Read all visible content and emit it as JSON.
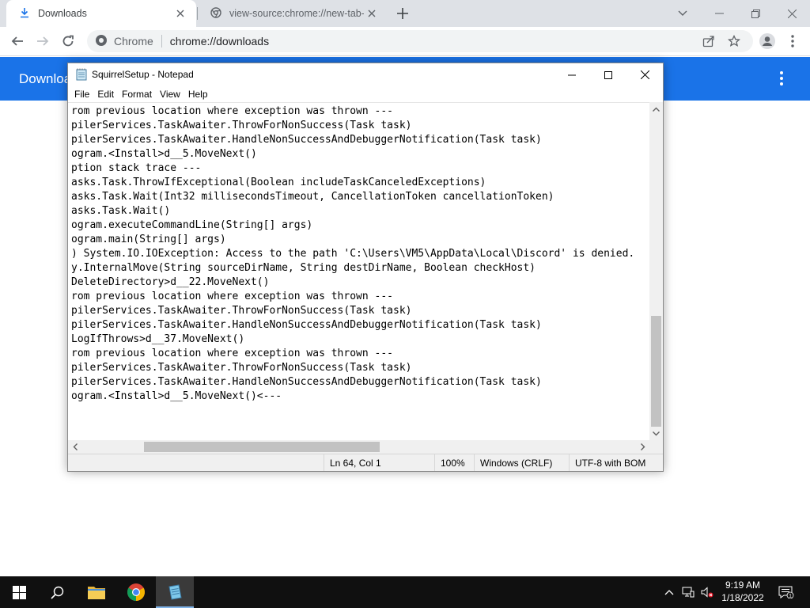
{
  "browser": {
    "tabs": [
      {
        "title": "Downloads"
      },
      {
        "title": "view-source:chrome://new-tab-p"
      }
    ],
    "omnibox": {
      "site_label": "Chrome",
      "url": "chrome://downloads"
    }
  },
  "downloads_page": {
    "title": "Downloads"
  },
  "notepad": {
    "title": "SquirrelSetup - Notepad",
    "menu": [
      "File",
      "Edit",
      "Format",
      "View",
      "Help"
    ],
    "lines": [
      "rom previous location where exception was thrown ---",
      "pilerServices.TaskAwaiter.ThrowForNonSuccess(Task task)",
      "pilerServices.TaskAwaiter.HandleNonSuccessAndDebuggerNotification(Task task)",
      "ogram.<Install>d__5.MoveNext()",
      "ption stack trace ---",
      "asks.Task.ThrowIfExceptional(Boolean includeTaskCanceledExceptions)",
      "asks.Task.Wait(Int32 millisecondsTimeout, CancellationToken cancellationToken)",
      "asks.Task.Wait()",
      "ogram.executeCommandLine(String[] args)",
      "ogram.main(String[] args)",
      ") System.IO.IOException: Access to the path 'C:\\Users\\VM5\\AppData\\Local\\Discord' is denied.",
      "y.InternalMove(String sourceDirName, String destDirName, Boolean checkHost)",
      "DeleteDirectory>d__22.MoveNext()",
      "rom previous location where exception was thrown ---",
      "pilerServices.TaskAwaiter.ThrowForNonSuccess(Task task)",
      "pilerServices.TaskAwaiter.HandleNonSuccessAndDebuggerNotification(Task task)",
      "LogIfThrows>d__37.MoveNext()",
      "rom previous location where exception was thrown ---",
      "pilerServices.TaskAwaiter.ThrowForNonSuccess(Task task)",
      "pilerServices.TaskAwaiter.HandleNonSuccessAndDebuggerNotification(Task task)",
      "ogram.<Install>d__5.MoveNext()<---"
    ],
    "status": {
      "position": "Ln 64, Col 1",
      "zoom": "100%",
      "line_endings": "Windows (CRLF)",
      "encoding": "UTF-8 with BOM"
    }
  },
  "taskbar": {
    "clock": {
      "time": "9:19 AM",
      "date": "1/18/2022"
    },
    "notification_count": "1"
  },
  "colors": {
    "chrome_tabstrip": "#dee1e6",
    "downloads_header": "#1a73e8",
    "taskbar": "#101010"
  }
}
